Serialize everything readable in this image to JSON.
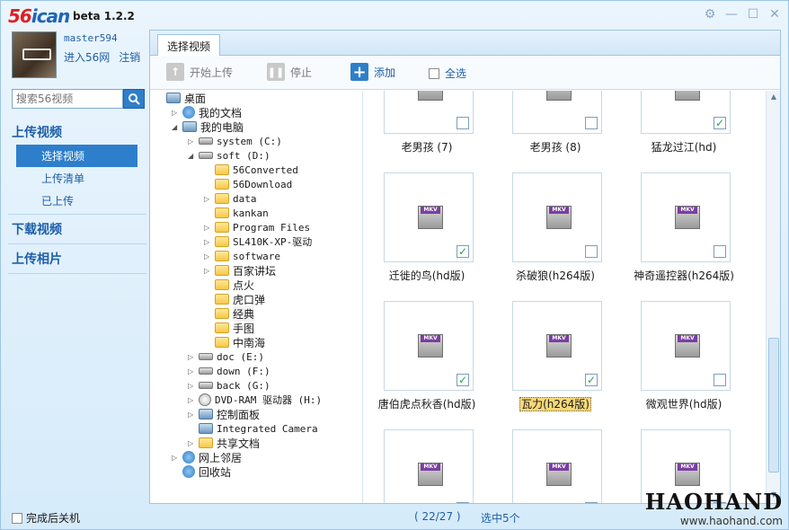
{
  "app": {
    "logo_a": "56",
    "logo_b": "ican",
    "version": "beta 1.2.2"
  },
  "window_buttons": [
    "settings-icon",
    "minimize-icon",
    "maximize-icon",
    "close-icon"
  ],
  "user": {
    "name": "master594",
    "enter": "进入56网",
    "logout": "注销"
  },
  "search": {
    "placeholder": "搜索56视频"
  },
  "nav": {
    "upload": "上传视频",
    "select": "选择视频",
    "list": "上传清单",
    "done": "已上传",
    "download": "下载视频",
    "photos": "上传相片"
  },
  "tab": "选择视频",
  "toolbar": {
    "start": "开始上传",
    "stop": "停止",
    "add": "添加",
    "select_all": "全选"
  },
  "tree": [
    {
      "label": "桌面"
    },
    {
      "label": "我的文档"
    },
    {
      "label": "我的电脑"
    },
    {
      "label": "system (C:)"
    },
    {
      "label": "soft (D:)"
    },
    {
      "label": "56Converted"
    },
    {
      "label": "56Download"
    },
    {
      "label": "data"
    },
    {
      "label": "kankan"
    },
    {
      "label": "Program Files"
    },
    {
      "label": "SL410K-XP-驱动"
    },
    {
      "label": "software"
    },
    {
      "label": "百家讲坛"
    },
    {
      "label": "点火"
    },
    {
      "label": "虎口弹"
    },
    {
      "label": "经典"
    },
    {
      "label": "手图"
    },
    {
      "label": "中南海"
    },
    {
      "label": "doc (E:)"
    },
    {
      "label": "down (F:)"
    },
    {
      "label": "back (G:)"
    },
    {
      "label": "DVD-RAM 驱动器 (H:)"
    },
    {
      "label": "控制面板"
    },
    {
      "label": "Integrated Camera"
    },
    {
      "label": "共享文档"
    },
    {
      "label": "网上邻居"
    },
    {
      "label": "回收站"
    }
  ],
  "videos": [
    {
      "title": "老男孩 (7)",
      "checked": false
    },
    {
      "title": "老男孩 (8)",
      "checked": false
    },
    {
      "title": "猛龙过江(hd)",
      "checked": true
    },
    {
      "title": "迁徙的鸟(hd版)",
      "checked": true
    },
    {
      "title": "杀破狼(h264版)",
      "checked": false
    },
    {
      "title": "神奇遥控器(h264版)",
      "checked": false
    },
    {
      "title": "唐伯虎点秋香(hd版)",
      "checked": true
    },
    {
      "title": "瓦力(h264版)",
      "checked": true
    },
    {
      "title": "微观世界(hd版)",
      "checked": false
    },
    {
      "title": "",
      "checked": false
    },
    {
      "title": "",
      "checked": false
    },
    {
      "title": "",
      "checked": false
    }
  ],
  "mkv_label": "MKV",
  "status": {
    "shutdown": "完成后关机",
    "count": "( 22/27 )",
    "selected": "选中5个"
  },
  "watermark": {
    "brand": "HAOHAND",
    "url": "www.haohand.com"
  },
  "colors": {
    "accent": "#2d7fcc",
    "check": "#2aa14a",
    "highlight": "#f7d878"
  }
}
